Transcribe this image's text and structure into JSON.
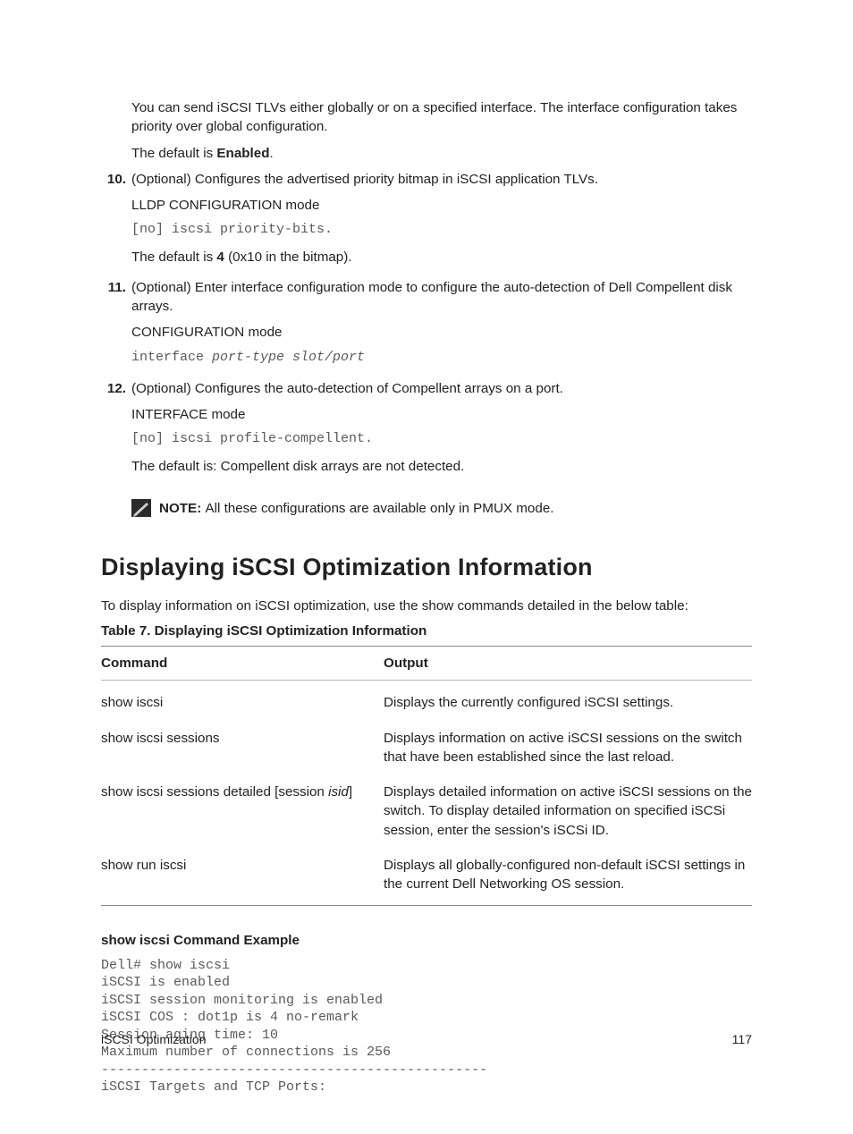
{
  "intro_para": "You can send iSCSI TLVs either globally or on a specified interface. The interface configuration takes priority over global configuration.",
  "default_prefix": "The default is ",
  "default_bold": "Enabled",
  "steps": {
    "s10": {
      "num": "10.",
      "text": "(Optional) Configures the advertised priority bitmap in iSCSI application TLVs.",
      "mode": "LLDP CONFIGURATION mode",
      "code": "[no] iscsi priority-bits.",
      "after_pre": "The default is ",
      "after_bold": "4",
      "after_post": " (0x10 in the bitmap)."
    },
    "s11": {
      "num": "11.",
      "text": "(Optional) Enter interface configuration mode to configure the auto-detection of Dell Compellent disk arrays.",
      "mode": "CONFIGURATION mode",
      "code_plain": "interface ",
      "code_ital": "port-type slot/port"
    },
    "s12": {
      "num": "12.",
      "text": "(Optional) Configures the auto-detection of Compellent arrays on a port.",
      "mode": "INTERFACE mode",
      "code": "[no] iscsi profile-compellent.",
      "after": "The default is: Compellent disk arrays are not detected."
    }
  },
  "note_label": "NOTE: ",
  "note_text": "All these configurations are available only in PMUX mode.",
  "heading": "Displaying iSCSI Optimization Information",
  "intro2": "To display information on iSCSI optimization, use the show commands detailed in the below table:",
  "caption": "Table 7. Displaying iSCSI Optimization Information",
  "table": {
    "h1": "Command",
    "h2": "Output",
    "rows": [
      {
        "cmd": "show iscsi",
        "out": "Displays the currently configured iSCSI settings."
      },
      {
        "cmd": "show iscsi sessions",
        "out": "Displays information on active iSCSI sessions on the switch that have been established since the last reload."
      },
      {
        "cmd_pre": "show iscsi sessions detailed [session ",
        "cmd_ital": "isid",
        "cmd_post": "]",
        "out": "Displays detailed information on active iSCSI sessions on the switch. To display detailed information on specified iSCSi session, enter the session's iSCSi ID."
      },
      {
        "cmd": "show run iscsi",
        "out": "Displays all globally-configured non-default iSCSI settings in the current Dell Networking OS session."
      }
    ]
  },
  "example_head": "show iscsi Command Example",
  "example_code": "Dell# show iscsi\niSCSI is enabled\niSCSI session monitoring is enabled\niSCSI COS : dot1p is 4 no-remark\nSession aging time: 10\nMaximum number of connections is 256\n------------------------------------------------\niSCSI Targets and TCP Ports:",
  "footer_left": "iSCSI Optimization",
  "footer_right": "117"
}
